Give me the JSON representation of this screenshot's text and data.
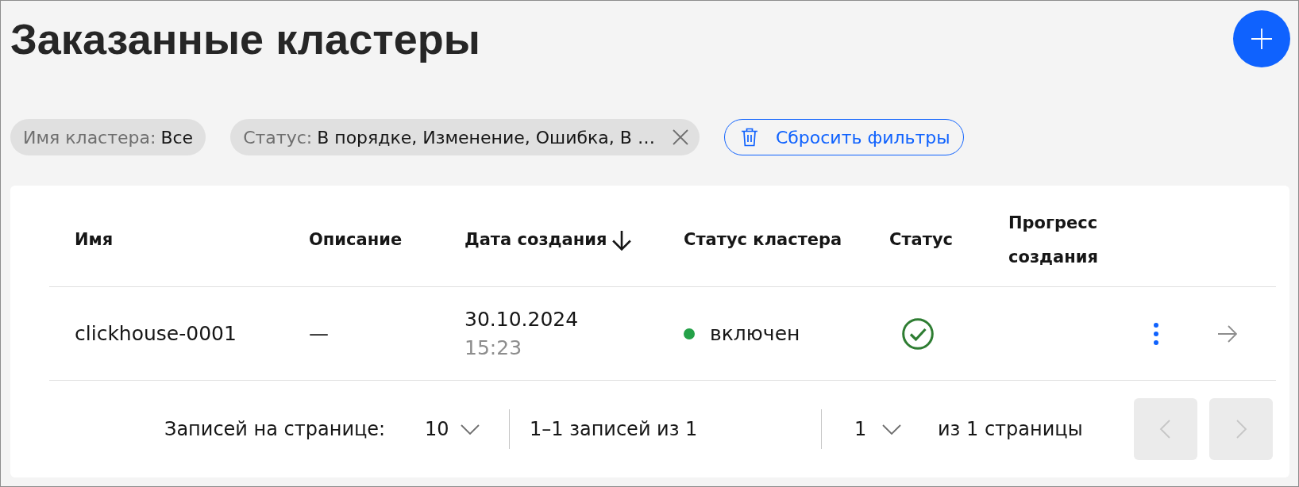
{
  "page": {
    "title": "Заказанные кластеры"
  },
  "filters": [
    {
      "label": "Имя кластера:",
      "value": "Все",
      "removable": false
    },
    {
      "label": "Статус:",
      "value": "В порядке, Изменение, Ошибка, В …",
      "removable": true
    }
  ],
  "reset_filters": {
    "label": "Сбросить фильтры"
  },
  "table": {
    "columns": [
      {
        "label": "Имя",
        "sorted_descending": false
      },
      {
        "label": "Описание",
        "sorted_descending": false
      },
      {
        "label": "Дата создания",
        "sorted_descending": true
      },
      {
        "label": "Статус кластера",
        "sorted_descending": false
      },
      {
        "label": "Статус",
        "sorted_descending": false
      },
      {
        "label": "Прогресс создания",
        "sorted_descending": false
      }
    ],
    "rows": [
      {
        "name": "clickhouse-0001",
        "description": "—",
        "created_date": "30.10.2024",
        "created_time": "15:23",
        "cluster_status": {
          "label": "включен",
          "color": "#24a148"
        },
        "status_ok": true
      }
    ]
  },
  "pagination": {
    "per_page_label": "Записей на странице:",
    "per_page": "10",
    "range": "1–1 записей из 1",
    "page": "1",
    "pages_label": "из 1 страницы",
    "prev": {
      "disabled": true
    },
    "next": {
      "disabled": true
    }
  }
}
